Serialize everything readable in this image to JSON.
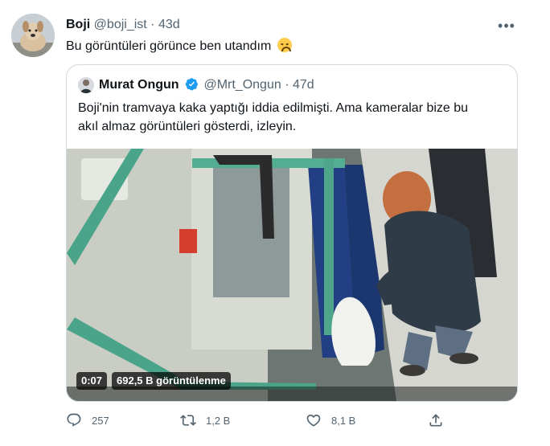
{
  "tweet": {
    "display_name": "Boji",
    "handle": "@boji_ist",
    "separator": "·",
    "time": "43d",
    "text": "Bu görüntüleri görünce ben utandım"
  },
  "quoted": {
    "display_name": "Murat Ongun",
    "handle": "@Mrt_Ongun",
    "separator": "·",
    "time": "47d",
    "text_line1": "Boji'nin tramvaya kaka yaptığı iddia edilmişti. Ama kameralar bize bu",
    "text_line2": "akıl almaz görüntüleri gösterdi, izleyin.",
    "video": {
      "duration": "0:07",
      "views": "692,5 B görüntülenme"
    }
  },
  "actions": {
    "reply_count": "257",
    "retweet_count": "1,2 B",
    "like_count": "8,1 B"
  },
  "icons": {
    "more": "more-horizontal-icon",
    "reply": "reply-icon",
    "retweet": "retweet-icon",
    "like": "heart-icon",
    "share": "share-icon",
    "verified": "verified-badge-icon"
  },
  "colors": {
    "text": "#0f1419",
    "secondary": "#536471",
    "verified": "#1d9bf0",
    "border": "#cfd9de"
  }
}
